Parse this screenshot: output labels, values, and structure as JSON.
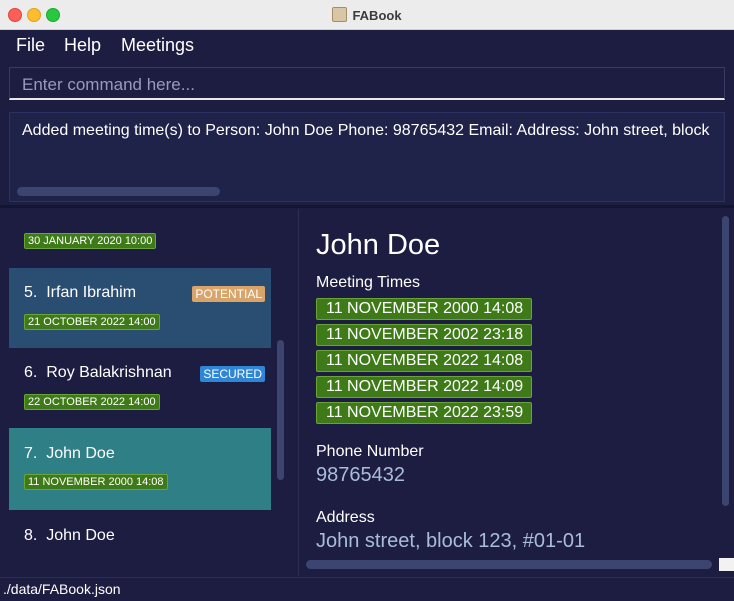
{
  "window": {
    "title": "FABook"
  },
  "menu": {
    "file": "File",
    "help": "Help",
    "meetings": "Meetings"
  },
  "command": {
    "placeholder": "Enter command here...",
    "value": ""
  },
  "result": {
    "text": "Added meeting time(s) to Person: John Doe Phone: 98765432 Email:  Address: John street, block"
  },
  "list": {
    "items": [
      {
        "index": "",
        "name": "",
        "tag": "",
        "date": "30 JANUARY 2020 10:00"
      },
      {
        "index": "5.",
        "name": "Irfan Ibrahim",
        "tag": "POTENTIAL",
        "date": "21 OCTOBER 2022 14:00"
      },
      {
        "index": "6.",
        "name": "Roy Balakrishnan",
        "tag": "SECURED",
        "date": "22 OCTOBER 2022 14:00"
      },
      {
        "index": "7.",
        "name": "John Doe",
        "tag": "",
        "date": "11 NOVEMBER 2000 14:08"
      },
      {
        "index": "8.",
        "name": "John Doe",
        "tag": "",
        "date": ""
      }
    ]
  },
  "detail": {
    "name": "John Doe",
    "meeting_label": "Meeting Times",
    "meetings": [
      "11 NOVEMBER 2000 14:08",
      "11 NOVEMBER 2002 23:18",
      "11 NOVEMBER 2022 14:08",
      "11 NOVEMBER 2022 14:09",
      "11 NOVEMBER 2022 23:59"
    ],
    "phone_label": "Phone Number",
    "phone": "98765432",
    "address_label": "Address",
    "address": "John street, block 123, #01-01"
  },
  "status": {
    "path": "./data/FABook.json"
  },
  "colors": {
    "background": "#1d1d42",
    "tag_potential": "#d8a469",
    "tag_secured": "#2f86d6",
    "meeting_tag": "#3f7a19",
    "selected_card": "#2f7f86",
    "alt_card": "#2a4d72"
  }
}
